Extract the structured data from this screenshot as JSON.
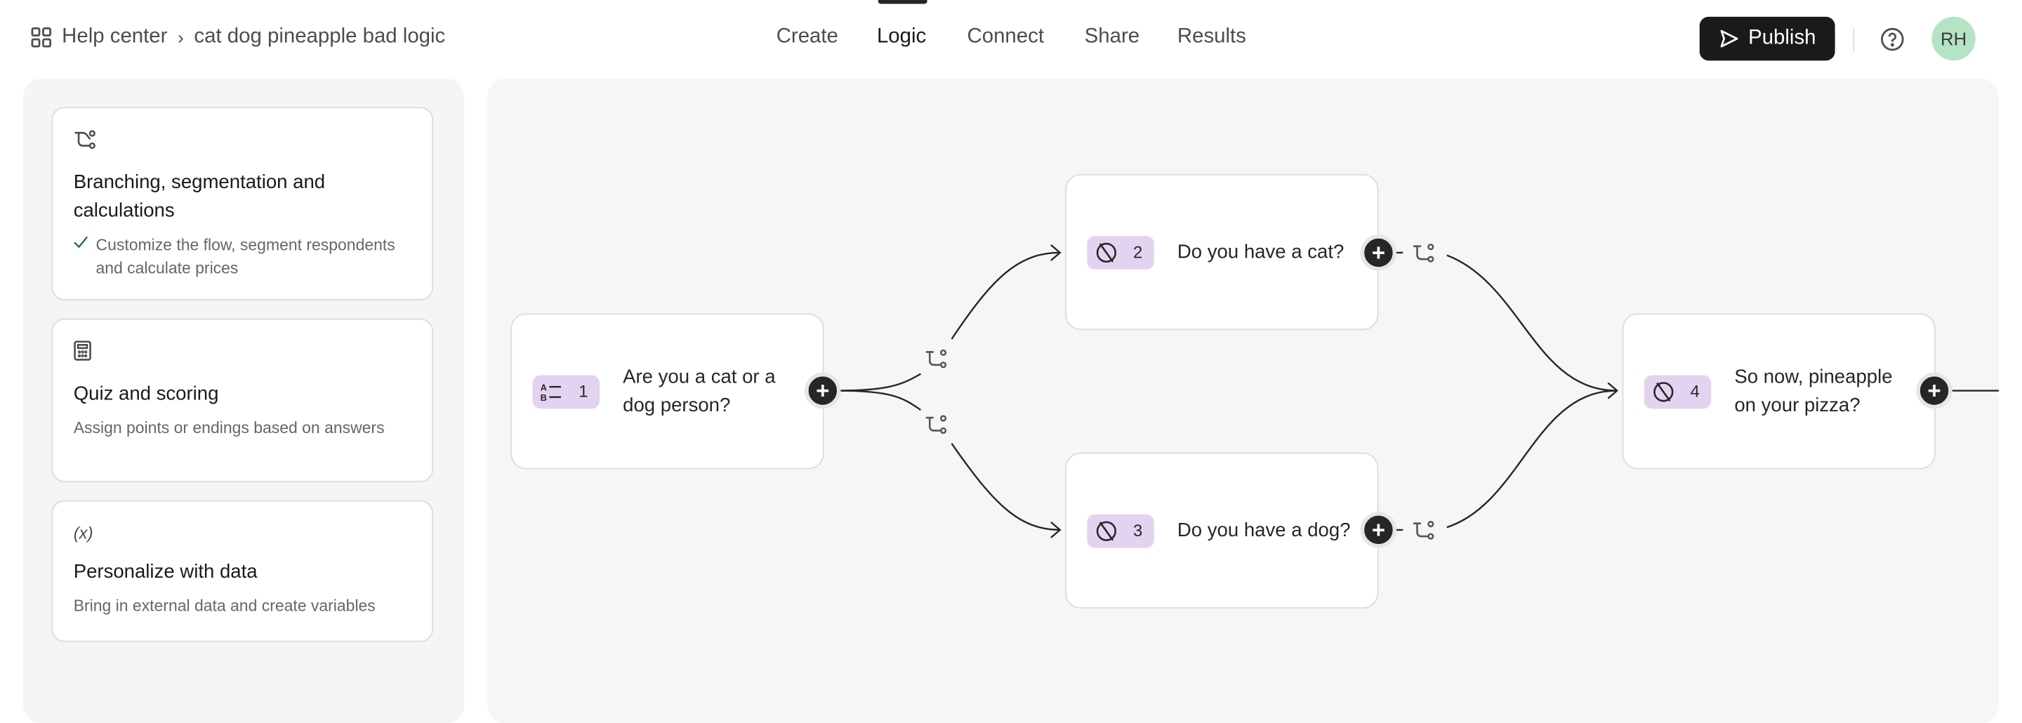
{
  "header": {
    "breadcrumb_root": "Help center",
    "breadcrumb_current": "cat dog pineapple bad logic",
    "tabs": [
      {
        "label": "Create"
      },
      {
        "label": "Logic",
        "active": true
      },
      {
        "label": "Connect"
      },
      {
        "label": "Share"
      },
      {
        "label": "Results"
      }
    ],
    "publish_label": "Publish",
    "avatar_initials": "RH",
    "avatar_color": "#b5e4c4"
  },
  "sidebar": {
    "cards": [
      {
        "icon": "branch-icon",
        "title": "Branching, segmentation and calculations",
        "description": "Customize the flow, segment respondents and calculate prices",
        "checked": true
      },
      {
        "icon": "calculator-icon",
        "title": "Quiz and scoring",
        "description": "Assign points or endings based on answers"
      },
      {
        "icon": "variable-icon",
        "title": "Personalize with data",
        "description": "Bring in external data and create variables"
      }
    ]
  },
  "flow": {
    "badge_color": "#e4d3f0",
    "nodes": [
      {
        "number": "1",
        "icon": "multiple-choice-icon",
        "text": "Are you a cat or a dog person?"
      },
      {
        "number": "2",
        "icon": "yes-no-icon",
        "text": "Do you have a cat?"
      },
      {
        "number": "3",
        "icon": "yes-no-icon",
        "text": "Do you have a dog?"
      },
      {
        "number": "4",
        "icon": "yes-no-icon",
        "text": "So now, pineapple on your pizza?"
      }
    ]
  }
}
